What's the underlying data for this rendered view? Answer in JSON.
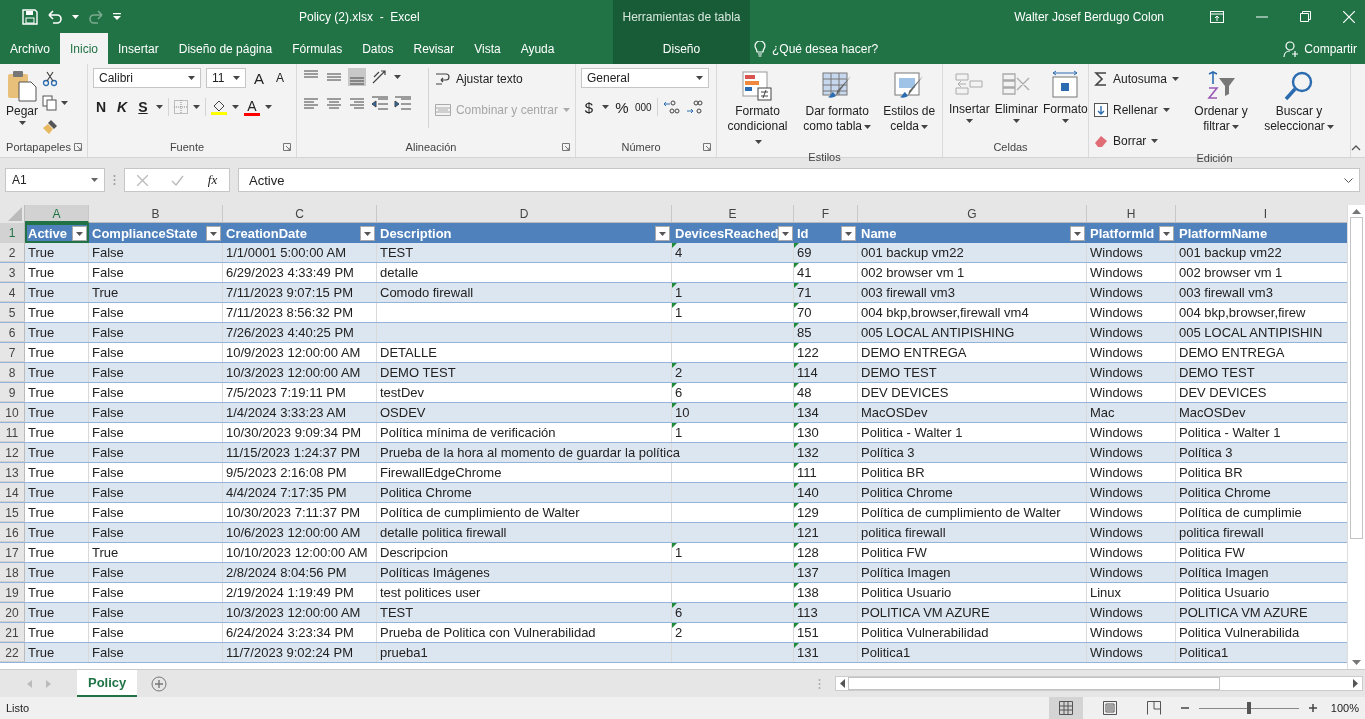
{
  "title_bar": {
    "title": "Policy (2).xlsx  -  Excel",
    "context_label": "Herramientas de tabla",
    "user": "Walter Josef Berdugo Colon",
    "redo_disabled": true
  },
  "ribbon_tabs": [
    {
      "label": "Archivo",
      "kind": "standard",
      "selected": false
    },
    {
      "label": "Inicio",
      "kind": "standard",
      "selected": true
    },
    {
      "label": "Insertar",
      "kind": "standard",
      "selected": false
    },
    {
      "label": "Diseño de página",
      "kind": "standard",
      "selected": false
    },
    {
      "label": "Fórmulas",
      "kind": "standard",
      "selected": false
    },
    {
      "label": "Datos",
      "kind": "standard",
      "selected": false
    },
    {
      "label": "Revisar",
      "kind": "standard",
      "selected": false
    },
    {
      "label": "Vista",
      "kind": "standard",
      "selected": false
    },
    {
      "label": "Ayuda",
      "kind": "standard",
      "selected": false
    },
    {
      "label": "Diseño",
      "kind": "contextual",
      "selected": false
    }
  ],
  "tell_me": "¿Qué desea hacer?",
  "share": "Compartir",
  "ribbon": {
    "clipboard": {
      "label": "Portapapeles",
      "paste": "Pegar"
    },
    "font": {
      "label": "Fuente",
      "family": "Calibri",
      "size": "11",
      "grow": "A",
      "shrink": "A",
      "bold": "N",
      "italic": "K",
      "underline": "S",
      "font_color": "A"
    },
    "alignment": {
      "label": "Alineación",
      "wrap": "Ajustar texto",
      "merge": {
        "label": "Combinar y centrar",
        "disabled": true
      }
    },
    "number": {
      "label": "Número",
      "format": "General",
      "currency": "$",
      "percent": "%",
      "thousands": "000"
    },
    "styles": {
      "label": "Estilos",
      "buttons": [
        "Formato condicional",
        "Dar formato como tabla",
        "Estilos de celda"
      ]
    },
    "cells": {
      "label": "Celdas",
      "buttons": [
        "Insertar",
        "Eliminar",
        "Formato"
      ]
    },
    "editing": {
      "label": "Edición",
      "small": [
        "Autosuma",
        "Rellenar",
        "Borrar"
      ],
      "big": [
        "Ordenar y filtrar",
        "Buscar y seleccionar"
      ]
    }
  },
  "formula_bar": {
    "name_box": "A1",
    "function_label": "fx",
    "formula": "Active"
  },
  "sheet": {
    "columns": [
      {
        "letter": "A",
        "selected": true
      },
      {
        "letter": "B",
        "selected": false
      },
      {
        "letter": "C",
        "selected": false
      },
      {
        "letter": "D",
        "selected": false
      },
      {
        "letter": "E",
        "selected": false
      },
      {
        "letter": "F",
        "selected": false
      },
      {
        "letter": "G",
        "selected": false
      },
      {
        "letter": "H",
        "selected": false
      },
      {
        "letter": "I",
        "selected": false
      }
    ],
    "header_row": {
      "number": "1",
      "selected": true,
      "cells": [
        {
          "text": "Active",
          "selected": true,
          "filter": true
        },
        {
          "text": "ComplianceState",
          "selected": false,
          "filter": true
        },
        {
          "text": "CreationDate",
          "selected": false,
          "filter": true
        },
        {
          "text": "Description",
          "selected": false,
          "filter": true
        },
        {
          "text": "DevicesReached",
          "selected": false,
          "filter": true
        },
        {
          "text": "Id",
          "selected": false,
          "filter": true
        },
        {
          "text": "Name",
          "selected": false,
          "filter": true
        },
        {
          "text": "PlatformId",
          "selected": false,
          "filter": true
        },
        {
          "text": "PlatformName",
          "selected": false,
          "filter": false
        }
      ]
    },
    "rows": [
      {
        "number": "2",
        "cells": [
          "True",
          "False",
          "1/1/0001 5:00:00 AM",
          "TEST",
          "4",
          "69",
          "001 backup vm22",
          "Windows",
          "001 backup vm22"
        ]
      },
      {
        "number": "3",
        "cells": [
          "True",
          "False",
          "6/29/2023 4:33:49 PM",
          "detalle",
          null,
          "41",
          "002 browser vm 1",
          "Windows",
          "002 browser vm 1"
        ]
      },
      {
        "number": "4",
        "cells": [
          "True",
          "True",
          "7/11/2023 9:07:15 PM",
          "Comodo firewall",
          "1",
          "71",
          "003 firewall vm3",
          "Windows",
          "003 firewall vm3"
        ]
      },
      {
        "number": "5",
        "cells": [
          "True",
          "False",
          "7/11/2023 8:56:32 PM",
          null,
          "1",
          "70",
          "004 bkp,browser,firewall vm4",
          "Windows",
          "004 bkp,browser,firew"
        ]
      },
      {
        "number": "6",
        "cells": [
          "True",
          "False",
          "7/26/2023 4:40:25 PM",
          null,
          null,
          "85",
          "005 LOCAL ANTIPISHING",
          "Windows",
          "005 LOCAL ANTIPISHIN"
        ]
      },
      {
        "number": "7",
        "cells": [
          "True",
          "False",
          "10/9/2023 12:00:00 AM",
          "DETALLE",
          null,
          "122",
          "DEMO ENTREGA",
          "Windows",
          "DEMO ENTREGA"
        ]
      },
      {
        "number": "8",
        "cells": [
          "True",
          "False",
          "10/3/2023 12:00:00 AM",
          "DEMO TEST",
          "2",
          "114",
          "DEMO TEST",
          "Windows",
          "DEMO TEST"
        ]
      },
      {
        "number": "9",
        "cells": [
          "True",
          "False",
          "7/5/2023 7:19:11 PM",
          "testDev",
          "6",
          "48",
          "DEV DEVICES",
          "Windows",
          "DEV DEVICES"
        ]
      },
      {
        "number": "10",
        "cells": [
          "True",
          "False",
          "1/4/2024 3:33:23 AM",
          "OSDEV",
          "10",
          "134",
          "MacOSDev",
          "Mac",
          "MacOSDev"
        ]
      },
      {
        "number": "11",
        "cells": [
          "True",
          "False",
          "10/30/2023 9:09:34 PM",
          "Política mínima de verificación",
          "1",
          "130",
          "Politica - Walter 1",
          "Windows",
          "Politica - Walter 1"
        ]
      },
      {
        "number": "12",
        "cells": [
          "True",
          "False",
          "11/15/2023 1:24:37 PM",
          "Prueba de la hora al momento de guardar la política",
          null,
          "132",
          "Política 3",
          "Windows",
          "Política 3"
        ]
      },
      {
        "number": "13",
        "cells": [
          "True",
          "False",
          "9/5/2023 2:16:08 PM",
          "FirewallEdgeChrome",
          null,
          "111",
          "Politica BR",
          "Windows",
          "Politica BR"
        ]
      },
      {
        "number": "14",
        "cells": [
          "True",
          "False",
          "4/4/2024 7:17:35 PM",
          "Politica Chrome",
          null,
          "140",
          "Politica Chrome",
          "Windows",
          "Politica Chrome"
        ]
      },
      {
        "number": "15",
        "cells": [
          "True",
          "False",
          "10/30/2023 7:11:37 PM",
          "Política de cumplimiento de Walter",
          null,
          "129",
          "Política de cumplimiento de Walter",
          "Windows",
          "Política de cumplimie"
        ]
      },
      {
        "number": "16",
        "cells": [
          "True",
          "False",
          "10/6/2023 12:00:00 AM",
          "detalle politica firewall",
          null,
          "121",
          "politica firewall",
          "Windows",
          "politica firewall"
        ]
      },
      {
        "number": "17",
        "cells": [
          "True",
          "True",
          "10/10/2023 12:00:00 AM",
          "Descripcion",
          "1",
          "128",
          "Politica FW",
          "Windows",
          "Politica FW"
        ]
      },
      {
        "number": "18",
        "cells": [
          "True",
          "False",
          "2/8/2024 8:04:56 PM",
          "Políticas Imágenes",
          null,
          "137",
          "Política Imagen",
          "Windows",
          "Política Imagen"
        ]
      },
      {
        "number": "19",
        "cells": [
          "True",
          "False",
          "2/19/2024 1:19:49 PM",
          "test politices user",
          null,
          "138",
          "Politica Usuario",
          "Linux",
          "Politica Usuario"
        ]
      },
      {
        "number": "20",
        "cells": [
          "True",
          "False",
          "10/3/2023 12:00:00 AM",
          "TEST",
          "6",
          "113",
          "POLITICA VM AZURE",
          "Windows",
          "POLITICA VM AZURE"
        ]
      },
      {
        "number": "21",
        "cells": [
          "True",
          "False",
          "6/24/2024 3:23:34 PM",
          "Prueba de Politica con Vulnerabilidad",
          "2",
          "151",
          "Politica Vulnerabilidad",
          "Windows",
          "Politica Vulnerabilida"
        ]
      },
      {
        "number": "22",
        "cells": [
          "True",
          "False",
          "11/7/2023 9:02:24 PM",
          "prueba1",
          null,
          "131",
          "Politica1",
          "Windows",
          "Politica1"
        ]
      }
    ]
  },
  "sheet_tabs": [
    {
      "label": "Policy",
      "selected": true
    }
  ],
  "status_bar": {
    "text": "Listo",
    "views": [
      {
        "kind": "normal",
        "selected": true
      },
      {
        "kind": "page-layout",
        "selected": false
      },
      {
        "kind": "page-break",
        "selected": false
      }
    ],
    "zoom": {
      "level": 0.5,
      "reading": "100%"
    }
  }
}
